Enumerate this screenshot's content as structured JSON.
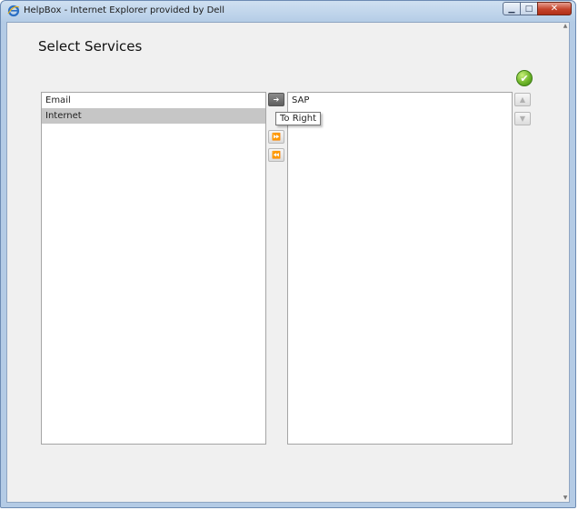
{
  "window": {
    "title": "HelpBox - Internet Explorer provided by Dell",
    "controls": {
      "minimize": "▁",
      "maximize": "□",
      "close": "✕"
    }
  },
  "page": {
    "title": "Select Services",
    "ok_icon": "✔"
  },
  "left_list": {
    "items": [
      {
        "label": "Email",
        "selected": false
      },
      {
        "label": "Internet",
        "selected": true
      }
    ]
  },
  "right_list": {
    "items": [
      {
        "label": "SAP",
        "selected": false
      }
    ]
  },
  "transfer_buttons": {
    "to_right": "➔",
    "all_right": "⏩",
    "all_left": "⏪"
  },
  "order_buttons": {
    "up": "▲",
    "down": "▼"
  },
  "tooltip": {
    "text": "To Right"
  },
  "icons": {
    "app": "ie-icon",
    "ok": "checkmark-icon"
  },
  "colors": {
    "ok_green": "#6fb52a",
    "selected_row": "#c6c6c6"
  }
}
